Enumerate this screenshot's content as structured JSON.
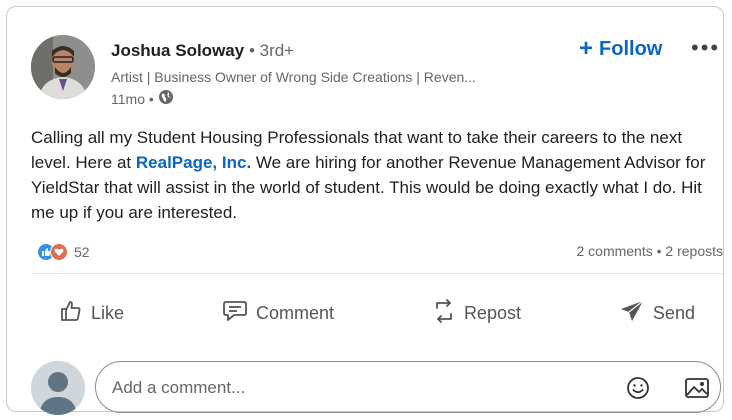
{
  "post": {
    "author": {
      "name": "Joshua Soloway",
      "degree": "• 3rd+",
      "headline": "Artist | Business Owner of Wrong Side Creations | Reven...",
      "time": "11mo •"
    },
    "follow_label": "Follow",
    "more_label": "•••",
    "body": {
      "part1": "Calling all my Student Housing Professionals that want to take their careers to the next level. Here at ",
      "mention": "RealPage, Inc.",
      "part2": " We are hiring for another Revenue Management Advisor for YieldStar that will assist in the world of student. This would be doing exactly what I do. Hit me up if you are interested."
    },
    "reactions_count": "52",
    "counts": "2 comments • 2 reposts"
  },
  "actions": {
    "like": "Like",
    "comment": "Comment",
    "repost": "Repost",
    "send": "Send"
  },
  "comment_box": {
    "placeholder": "Add a comment..."
  },
  "icons": {
    "globe": "globe-icon",
    "like": "thumbs-up-icon",
    "comment": "speech-bubble-icon",
    "repost": "repost-arrows-icon",
    "send": "paper-plane-icon",
    "emoji": "smiley-icon",
    "image": "image-icon"
  },
  "colors": {
    "accent": "#0a66c2",
    "like_reaction": "#378fe9",
    "love_reaction": "#df704d"
  }
}
